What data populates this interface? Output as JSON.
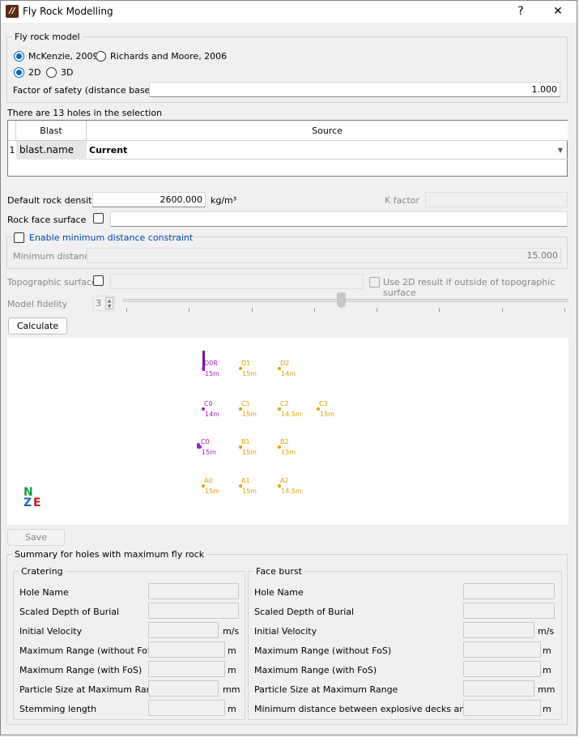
{
  "window": {
    "title": "Fly Rock Modelling",
    "help": "?",
    "close": "✕"
  },
  "model": {
    "group_label": "Fly rock model",
    "option_mckenzie": "McKenzie, 2009",
    "option_richards": "Richards and Moore, 2006",
    "option_2d": "2D",
    "option_3d": "3D",
    "fos_label": "Factor of safety (distance based)",
    "fos_value": "1.000"
  },
  "selection": {
    "text": "There are 13 holes in the selection"
  },
  "table": {
    "headers": [
      "Blast",
      "Source"
    ],
    "rows": [
      {
        "index": "1",
        "blast": "blast.name",
        "source": "Current"
      }
    ]
  },
  "params": {
    "density_label": "Default rock density",
    "density_value": "2600.000",
    "density_unit": "kg/m³",
    "kfactor_label": "K factor",
    "rockface_label": "Rock face surface",
    "min_dist_enable_label": "Enable minimum distance constraint",
    "min_dist_label": "Minimum distance",
    "min_dist_value": "15.000",
    "topo_label": "Topographic surface",
    "use2d_label": "Use 2D result if outside of topographic surface",
    "fidelity_label": "Model fidelity",
    "fidelity_value": "3",
    "fidelity_level": 0.5
  },
  "buttons": {
    "calculate": "Calculate",
    "save_polygon": "Save polygon"
  },
  "holes": [
    {
      "name": "D0R",
      "depth": "15m",
      "color": "#a020c0"
    },
    {
      "name": "D1",
      "depth": "15m",
      "color": "#e0a000"
    },
    {
      "name": "D2",
      "depth": "14m",
      "color": "#e0a000"
    },
    {
      "name": "C0",
      "depth": "14m",
      "color": "#a020c0"
    },
    {
      "name": "C1",
      "depth": "15m",
      "color": "#e0a000"
    },
    {
      "name": "C2",
      "depth": "14.5m",
      "color": "#e0a000"
    },
    {
      "name": "C3",
      "depth": "15m",
      "color": "#e0a000"
    },
    {
      "name": "C0",
      "depth": "15m",
      "color": "#a020c0"
    },
    {
      "name": "B1",
      "depth": "15m",
      "color": "#e0a000"
    },
    {
      "name": "B2",
      "depth": "15m",
      "color": "#e0a000"
    },
    {
      "name": "A0",
      "depth": "15m",
      "color": "#e0a000"
    },
    {
      "name": "A1",
      "depth": "15m",
      "color": "#e0a000"
    },
    {
      "name": "A2",
      "depth": "14.5m",
      "color": "#e0a000"
    }
  ],
  "compass": {
    "north": "N",
    "east": "E"
  },
  "summary": {
    "group_label": "Summary for holes with maximum fly rock",
    "cratering": {
      "title": "Cratering",
      "rows": [
        {
          "label": "Hole Name",
          "unit": ""
        },
        {
          "label": "Scaled Depth of Burial",
          "unit": ""
        },
        {
          "label": "Initial Velocity",
          "unit": "m/s"
        },
        {
          "label": "Maximum Range (without FoS)",
          "unit": "m"
        },
        {
          "label": "Maximum Range (with FoS)",
          "unit": "m"
        },
        {
          "label": "Particle Size at Maximum Range",
          "unit": "mm"
        },
        {
          "label": "Stemming length",
          "unit": "m"
        }
      ]
    },
    "faceburst": {
      "title": "Face burst",
      "rows": [
        {
          "label": "Hole Name",
          "unit": ""
        },
        {
          "label": "Scaled Depth of Burial",
          "unit": ""
        },
        {
          "label": "Initial Velocity",
          "unit": "m/s"
        },
        {
          "label": "Maximum Range (without FoS)",
          "unit": "m"
        },
        {
          "label": "Maximum Range (with FoS)",
          "unit": "m"
        },
        {
          "label": "Particle Size at Maximum Range",
          "unit": "mm"
        },
        {
          "label": "Minimum distance between explosive decks and face",
          "unit": "m"
        }
      ]
    }
  },
  "colors": {
    "accent": "#0067c0",
    "purple": "#a020c0",
    "orange": "#e0a000",
    "north": "#1a9a3a",
    "east": "#c02020"
  }
}
